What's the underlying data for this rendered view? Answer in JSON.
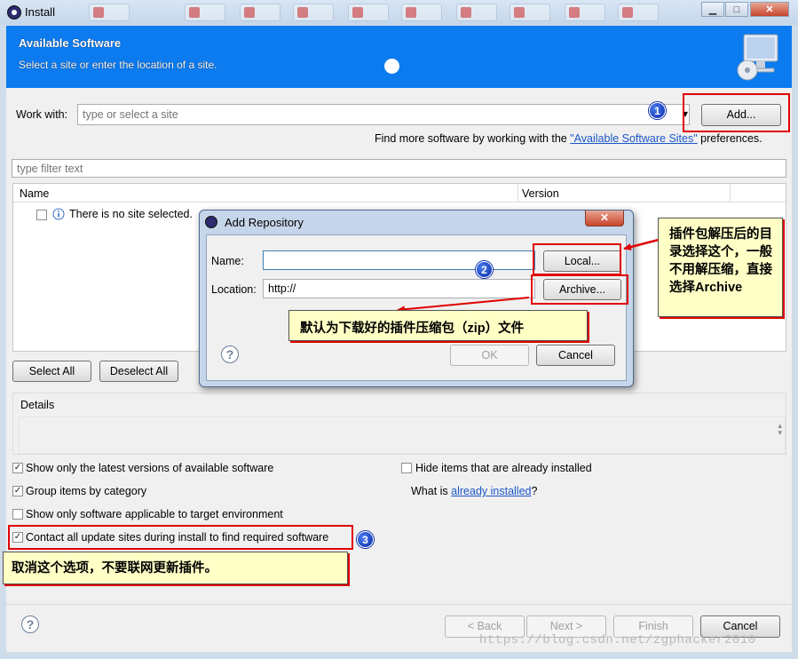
{
  "window": {
    "title": "Install",
    "controls": {
      "minimize": "▁",
      "maximize": "□",
      "close": "✕"
    }
  },
  "header": {
    "title": "Available Software",
    "subtitle": "Select a site or enter the location of a site."
  },
  "work_with": {
    "label": "Work with:",
    "placeholder": "type or select a site",
    "dropdown_glyph": "▾",
    "add_button": "Add...",
    "hint_prefix": "Find more software by working with the ",
    "hint_link": "\"Available Software Sites\"",
    "hint_suffix": " preferences."
  },
  "filter": {
    "placeholder": "type filter text"
  },
  "table": {
    "columns": [
      "Name",
      "Version"
    ],
    "empty_row": "There is no site selected."
  },
  "buttons": {
    "select_all": "Select All",
    "deselect_all": "Deselect All"
  },
  "details": {
    "label": "Details"
  },
  "options": {
    "latest_versions": {
      "label": "Show only the latest versions of available software",
      "checked": true
    },
    "hide_installed": {
      "label": "Hide items that are already installed",
      "checked": false
    },
    "group_by_category": {
      "label": "Group items by category",
      "checked": true
    },
    "what_is_prefix": "What is ",
    "what_is_link": "already installed",
    "what_is_suffix": "?",
    "target_env": {
      "label": "Show only software applicable to target environment",
      "checked": false
    },
    "contact_sites": {
      "label": "Contact all update sites during install to find required software",
      "checked": true
    }
  },
  "footer": {
    "back": "< Back",
    "next": "Next >",
    "finish": "Finish",
    "cancel": "Cancel"
  },
  "dialog": {
    "title": "Add Repository",
    "close": "✕",
    "name_label": "Name:",
    "name_value": "",
    "location_label": "Location:",
    "location_value": "http://",
    "local_button": "Local...",
    "archive_button": "Archive...",
    "ok_button": "OK",
    "cancel_button": "Cancel"
  },
  "annotations": {
    "num1": "1",
    "num2": "2",
    "num3": "3",
    "note_right": "插件包解压后的目录选择这个，一般不用解压缩，直接选择Archive",
    "note_archive": "默认为下载好的插件压缩包（zip）文件",
    "note_contact": "取消这个选项，不要联网更新插件。",
    "accent_red": "#e00000",
    "note_bg": "#ffffc6"
  },
  "watermark": "https://blog.csdn.net/zgphacker2010"
}
